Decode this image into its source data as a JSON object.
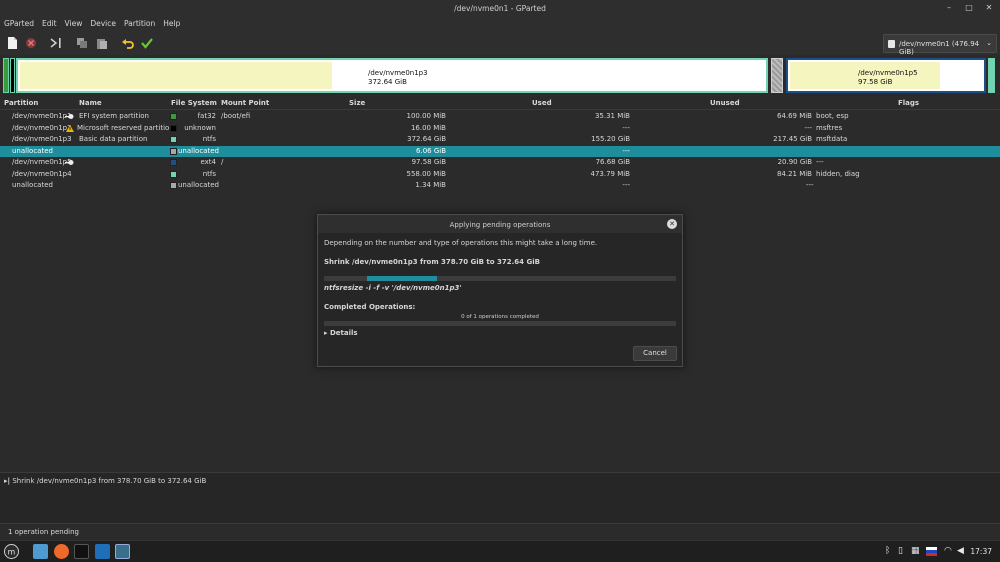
{
  "window": {
    "title": "/dev/nvme0n1 - GParted"
  },
  "menu": [
    "GParted",
    "Edit",
    "View",
    "Device",
    "Partition",
    "Help"
  ],
  "device_selector": {
    "label": "/dev/nvme0n1 (476.94 GiB)"
  },
  "graph": {
    "p3_name": "/dev/nvme0n1p3",
    "p3_size": "372.64 GiB",
    "p5_name": "/dev/nvme0n1p5",
    "p5_size": "97.58 GiB"
  },
  "table": {
    "headers": [
      "Partition",
      "Name",
      "File System",
      "Mount Point",
      "Size",
      "Used",
      "Unused",
      "Flags"
    ],
    "rows": [
      {
        "partition": "/dev/nvme0n1p1",
        "name": "EFI system partition",
        "fs": "fat32",
        "fs_color": "#3c9a3c",
        "mount": "/boot/efi",
        "size": "100.00 MiB",
        "used": "35.31 MiB",
        "unused": "64.69 MiB",
        "flags": "boot, esp"
      },
      {
        "partition": "/dev/nvme0n1p2",
        "name": "Microsoft reserved partition",
        "fs": "unknown",
        "fs_color": "#000000",
        "mount": "",
        "size": "16.00 MiB",
        "used": "---",
        "unused": "---",
        "flags": "msftres"
      },
      {
        "partition": "/dev/nvme0n1p3",
        "name": "Basic data partition",
        "fs": "ntfs",
        "fs_color": "#74d4b0",
        "mount": "",
        "size": "372.64 GiB",
        "used": "155.20 GiB",
        "unused": "217.45 GiB",
        "flags": "msftdata"
      },
      {
        "partition": "unallocated",
        "name": "",
        "fs": "unallocated",
        "fs_color": "#a8a8a8",
        "mount": "",
        "size": "6.06 GiB",
        "used": "---",
        "unused": "",
        "flags": ""
      },
      {
        "partition": "/dev/nvme0n1p5",
        "name": "",
        "fs": "ext4",
        "fs_color": "#1f4f86",
        "mount": "/",
        "size": "97.58 GiB",
        "used": "76.68 GiB",
        "unused": "20.90 GiB",
        "flags": "---"
      },
      {
        "partition": "/dev/nvme0n1p4",
        "name": "",
        "fs": "ntfs",
        "fs_color": "#74d4b0",
        "mount": "",
        "size": "558.00 MiB",
        "used": "473.79 MiB",
        "unused": "84.21 MiB",
        "flags": "hidden, diag"
      },
      {
        "partition": "unallocated",
        "name": "",
        "fs": "unallocated",
        "fs_color": "#a8a8a8",
        "mount": "",
        "size": "1.34 MiB",
        "used": "---",
        "unused": "",
        "flags": "---"
      }
    ]
  },
  "dialog": {
    "title": "Applying pending operations",
    "description": "Depending on the number and type of operations this might take a long time.",
    "operation": "Shrink /dev/nvme0n1p3 from 378.70 GiB to 372.64 GiB",
    "progress": 0.2,
    "command": "ntfsresize -i -f -v '/dev/nvme0n1p3'",
    "completed_label": "Completed Operations:",
    "completed_text": "0 of 1 operations completed",
    "details_label": "Details",
    "cancel_label": "Cancel"
  },
  "pending": {
    "operation": "Shrink /dev/nvme0n1p3 from 378.70 GiB to 372.64 GiB",
    "status": "1 operation pending"
  },
  "taskbar": {
    "clock": "17:37"
  },
  "colors": {
    "accent": "#1e8d9c",
    "ntfs": "#74d4b0",
    "ext4": "#1f4f86",
    "fat32": "#3c9a3c",
    "used_fill": "#f5f5c0"
  }
}
